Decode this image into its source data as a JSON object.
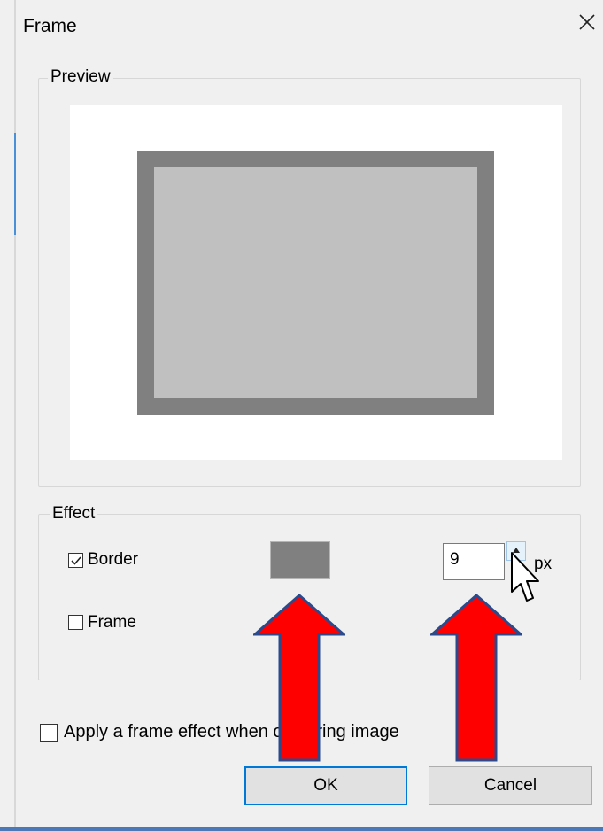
{
  "window": {
    "title": "Frame"
  },
  "preview": {
    "legend": "Preview",
    "border_color": "#808080",
    "fill_color": "#c0c0c0"
  },
  "effect": {
    "legend": "Effect",
    "border": {
      "label": "Border",
      "checked": true
    },
    "frame": {
      "label": "Frame",
      "checked": false
    },
    "color_swatch": "#808080",
    "size_value": "9",
    "size_unit": "px"
  },
  "apply_checkbox": {
    "label": "Apply a frame effect when capturing image",
    "checked": false
  },
  "buttons": {
    "ok": "OK",
    "cancel": "Cancel"
  },
  "annotation": {
    "arrow_color": "#ff0000",
    "arrow_outline": "#2b4a8c"
  }
}
